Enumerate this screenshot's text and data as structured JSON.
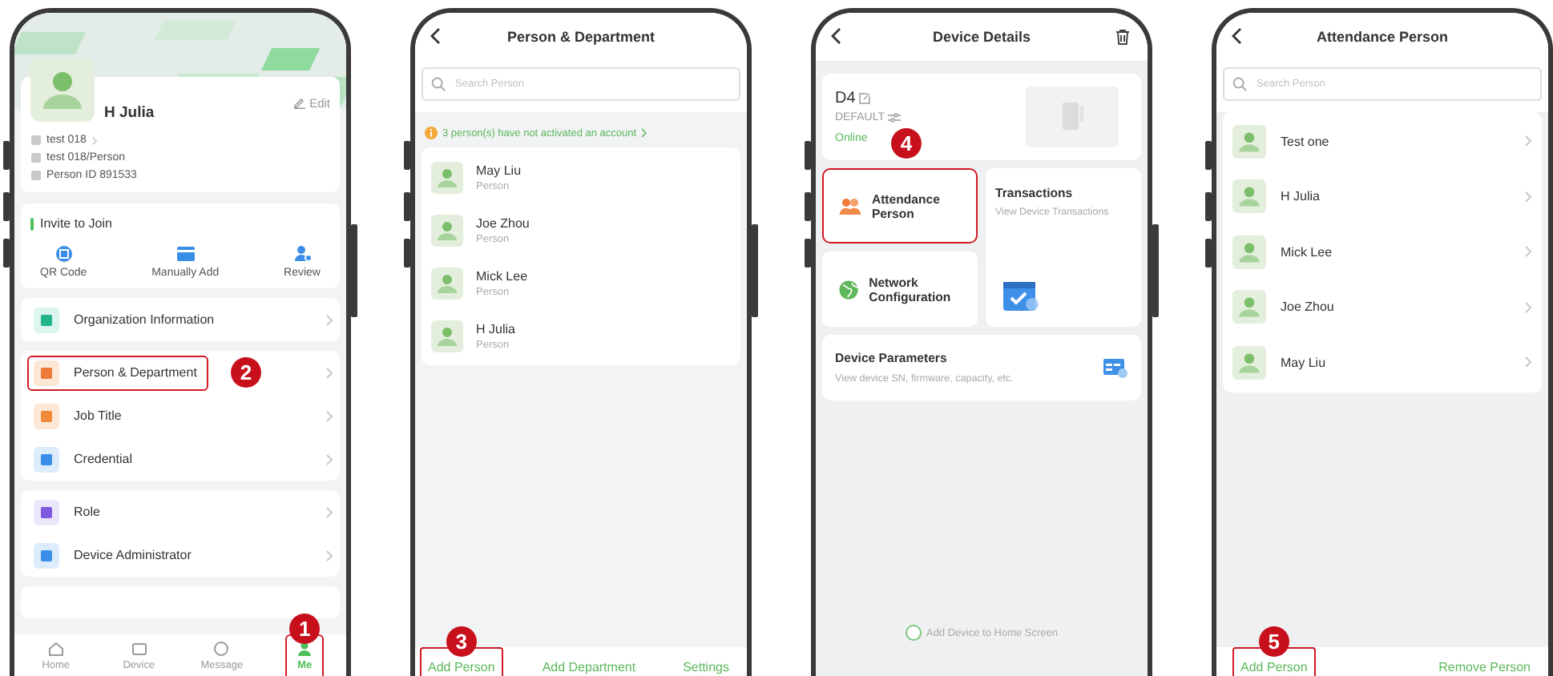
{
  "me_screen": {
    "name": "H Julia",
    "edit_label": "Edit",
    "info": [
      {
        "text": "test 018",
        "link": true
      },
      {
        "text": "test 018/Person",
        "link": false
      },
      {
        "text": "Person ID 891533",
        "link": false
      }
    ],
    "invite": {
      "title": "Invite to Join",
      "actions": [
        "QR Code",
        "Manually Add",
        "Review"
      ]
    },
    "menu_groups": [
      {
        "items": [
          {
            "label": "Organization Information",
            "highlighted": false
          }
        ]
      },
      {
        "items": [
          {
            "label": "Person & Department",
            "highlighted": true,
            "callout": "2"
          },
          {
            "label": "Job Title",
            "highlighted": false
          },
          {
            "label": "Credential",
            "highlighted": false
          }
        ]
      },
      {
        "items": [
          {
            "label": "Role",
            "highlighted": false
          },
          {
            "label": "Device Administrator",
            "highlighted": false
          }
        ]
      }
    ],
    "tabs": [
      {
        "label": "Home",
        "selected": false,
        "highlighted": false
      },
      {
        "label": "Device",
        "selected": false,
        "highlighted": false
      },
      {
        "label": "Message",
        "selected": false,
        "highlighted": false
      },
      {
        "label": "Me",
        "selected": true,
        "highlighted": true,
        "callout": "1"
      }
    ]
  },
  "person_department_screen": {
    "title": "Person & Department",
    "search": {
      "placeholder": "Search Person"
    },
    "notice": "3 person(s) have not activated an account",
    "persons": [
      {
        "name": "May Liu",
        "role": "Person"
      },
      {
        "name": "Joe Zhou",
        "role": "Person"
      },
      {
        "name": "Mick Lee",
        "role": "Person"
      },
      {
        "name": "H Julia",
        "role": "Person"
      }
    ],
    "actions": [
      {
        "label": "Add Person",
        "highlighted": true,
        "callout": "3"
      },
      {
        "label": "Add Department",
        "highlighted": false
      },
      {
        "label": "Settings",
        "highlighted": false
      }
    ]
  },
  "device_details_screen": {
    "title": "Device Details",
    "device": {
      "name": "D4",
      "group": "DEFAULT",
      "status": "Online"
    },
    "tiles": [
      {
        "title": "Attendance Person",
        "highlighted": true,
        "callout": "4"
      },
      {
        "title": "Transactions",
        "subtitle": "View Device Transactions",
        "highlighted": false
      },
      {
        "title": "Network Configuration",
        "highlighted": false
      }
    ],
    "parameters": {
      "title": "Device Parameters",
      "subtitle": "View device SN, firmware, capacity, etc."
    },
    "home_screen_option": {
      "label": "Add Device to Home Screen",
      "checked": false
    }
  },
  "attendance_person_screen": {
    "title": "Attendance Person",
    "search": {
      "placeholder": "Search Person"
    },
    "persons": [
      {
        "name": "Test one"
      },
      {
        "name": "H Julia"
      },
      {
        "name": "Mick Lee"
      },
      {
        "name": "Joe Zhou"
      },
      {
        "name": "May Liu"
      }
    ],
    "actions": [
      {
        "label": "Add Person",
        "highlighted": true,
        "callout": "5"
      },
      {
        "label": "Remove Person",
        "highlighted": false
      }
    ]
  }
}
